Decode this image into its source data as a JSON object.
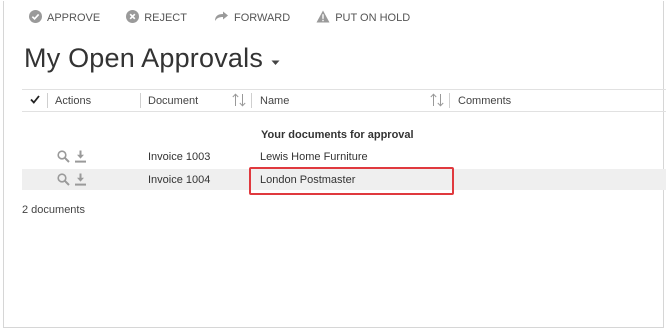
{
  "toolbar": {
    "approve_label": "APPROVE",
    "reject_label": "REJECT",
    "forward_label": "FORWARD",
    "hold_label": "PUT ON HOLD"
  },
  "view": {
    "title": "My Open Approvals"
  },
  "grid": {
    "columns": {
      "actions": "Actions",
      "document": "Document",
      "name": "Name",
      "comments": "Comments"
    },
    "group_label": "Your documents for approval",
    "rows": [
      {
        "document": "Invoice 1003",
        "name": "Lewis Home Furniture",
        "comments": ""
      },
      {
        "document": "Invoice 1004",
        "name": "London Postmaster",
        "comments": ""
      }
    ],
    "footer_count": "2 documents"
  },
  "colors": {
    "icon_gray": "#9a9a9a",
    "highlight_red": "#e0393e",
    "selected_row": "#efefef"
  },
  "icons": {
    "approve": "check-circle-icon",
    "reject": "x-circle-icon",
    "forward": "forward-arrow-icon",
    "hold": "warning-triangle-icon",
    "preview": "magnifier-icon",
    "download": "download-icon"
  }
}
